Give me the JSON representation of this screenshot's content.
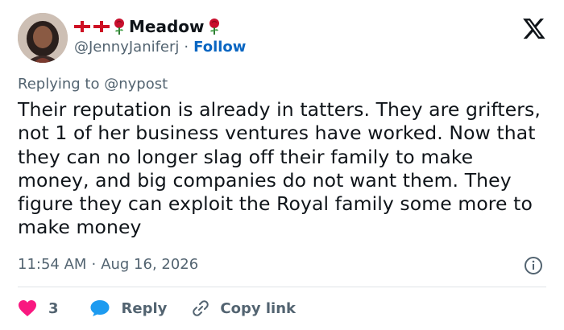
{
  "author": {
    "display_name": "Meadow",
    "handle": "@JennyJaniferj",
    "separator": "·",
    "follow_label": "Follow"
  },
  "reply_context": {
    "prefix": "Replying to",
    "mention": "@nypost"
  },
  "tweet": {
    "text": "Their reputation is already in tatters. They are grifters, not 1 of her business ventures have worked. Now that they can no longer slag off their family to make money, and big companies do not want them. They figure they can exploit the Royal family some more to make money",
    "time": "11:54 AM",
    "separator": "·",
    "date": "Aug 16, 2026"
  },
  "actions": {
    "like_count": "3",
    "reply_label": "Reply",
    "copy_label": "Copy link"
  },
  "colors": {
    "text": "#0f1419",
    "muted": "#536471",
    "link": "#0a66c2",
    "like": "#f91880",
    "reply_icon": "#1d9bf0",
    "rose": "#c8102e"
  },
  "icons": [
    "england-flag-icon",
    "rose-icon",
    "x-logo-icon",
    "info-icon",
    "heart-icon",
    "speech-bubble-icon",
    "link-icon"
  ]
}
